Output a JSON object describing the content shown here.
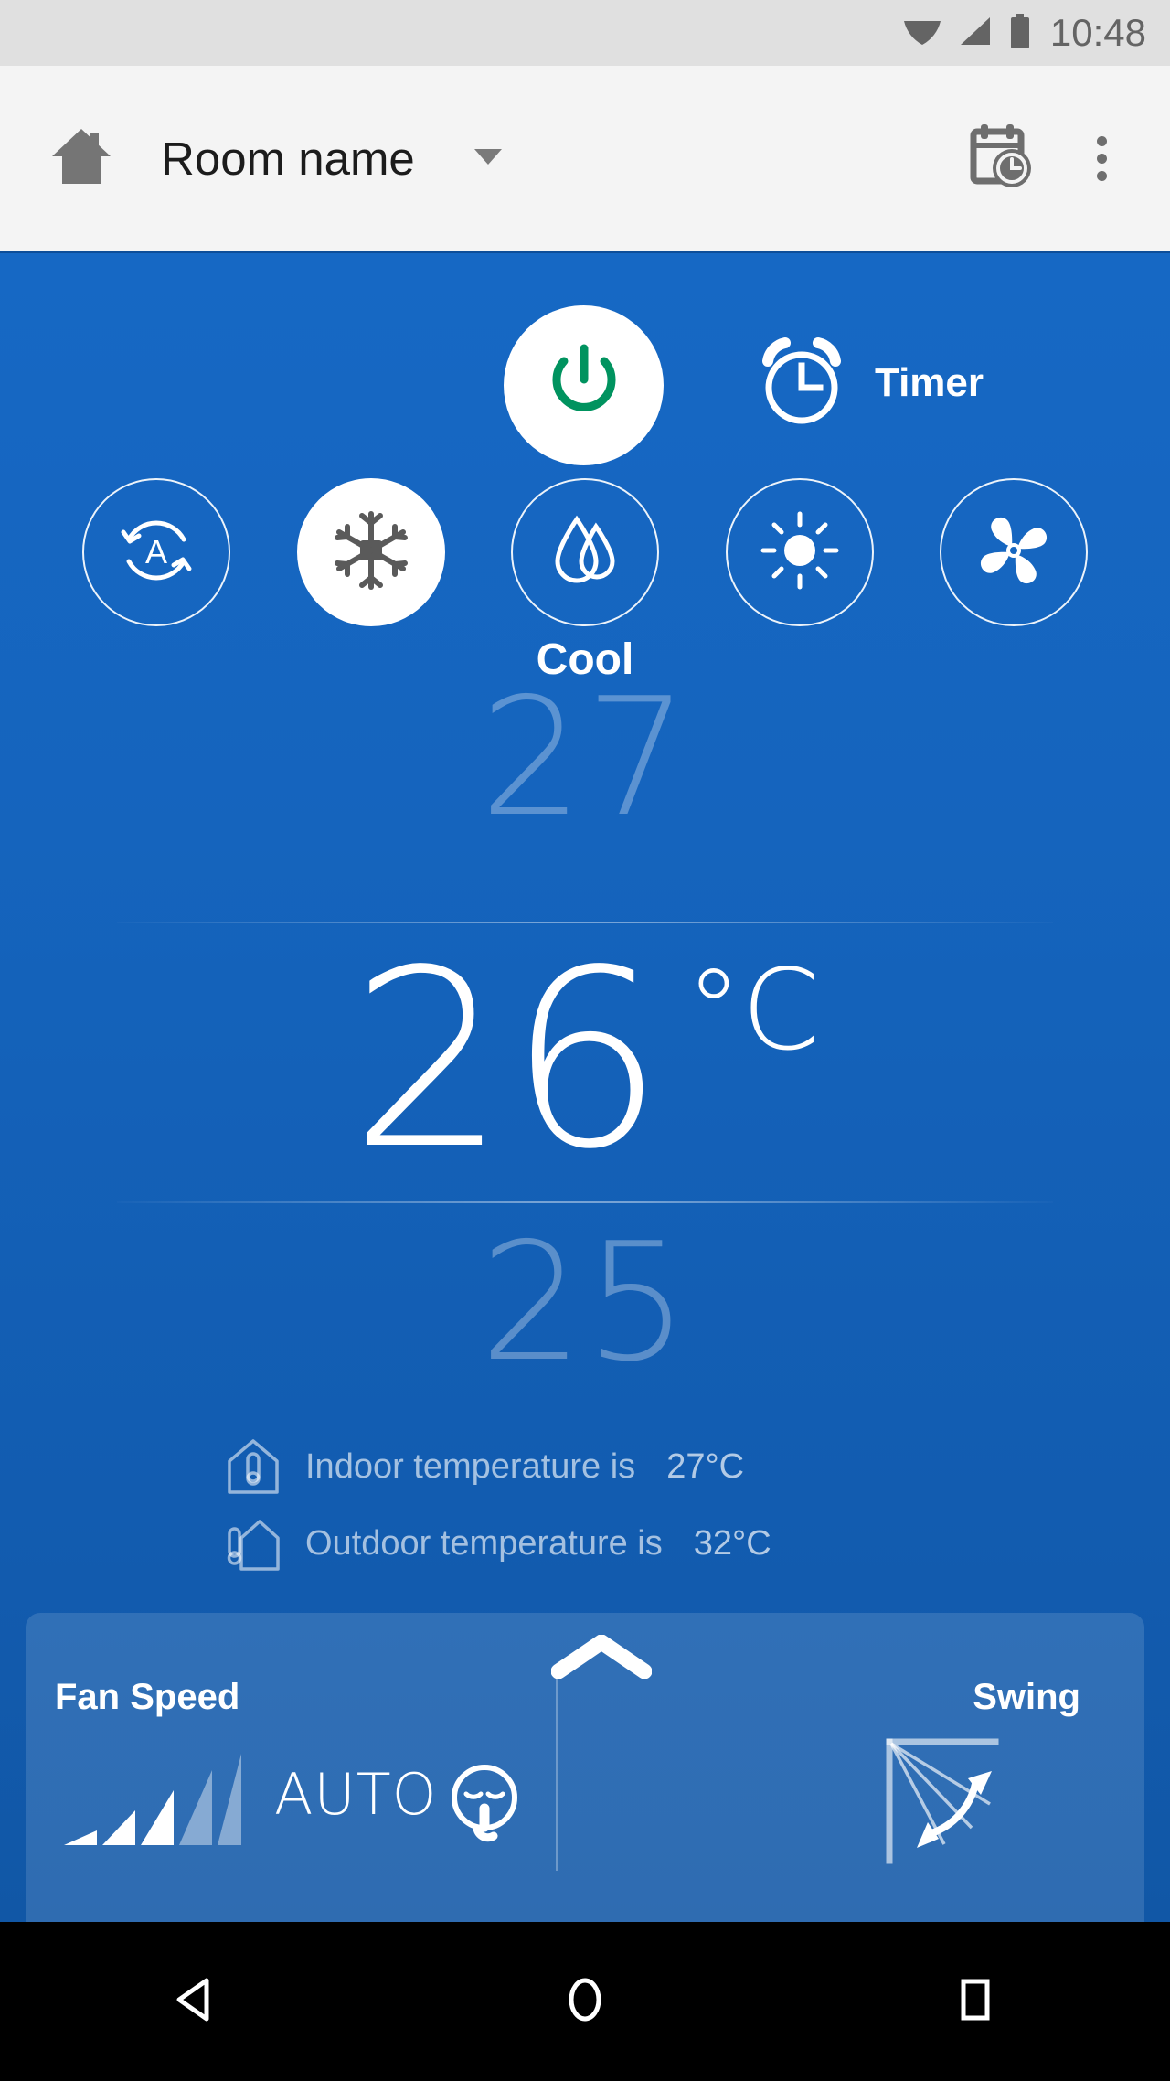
{
  "status_bar": {
    "time": "10:48",
    "icons": [
      "wifi-icon",
      "cellular-signal-icon",
      "battery-icon"
    ]
  },
  "app_bar": {
    "home_icon": "home-icon",
    "title": "Room name",
    "dropdown_icon": "chevron-down-icon",
    "schedule_icon": "calendar-clock-icon",
    "overflow_icon": "overflow-menu-icon"
  },
  "power": {
    "power_icon": "power-icon",
    "power_color": "#00935f",
    "timer_icon": "alarm-clock-icon",
    "timer_label": "Timer"
  },
  "modes": {
    "selected": "cool",
    "selected_label": "Cool",
    "items": [
      {
        "id": "auto",
        "icon": "auto-mode-icon",
        "selected": false
      },
      {
        "id": "cool",
        "icon": "snowflake-icon",
        "selected": true
      },
      {
        "id": "dry",
        "icon": "water-drop-icon",
        "selected": false
      },
      {
        "id": "heat",
        "icon": "sun-icon",
        "selected": false
      },
      {
        "id": "fan",
        "icon": "fan-icon",
        "selected": false
      }
    ]
  },
  "temperature": {
    "above": "27",
    "current": "26",
    "unit": "°C",
    "below": "25"
  },
  "readings": [
    {
      "icon": "indoor-thermometer-icon",
      "label": "Indoor temperature is",
      "value": "27°C"
    },
    {
      "icon": "outdoor-thermometer-icon",
      "label": "Outdoor temperature is",
      "value": "32°C"
    }
  ],
  "bottom_panel": {
    "expand_icon": "chevron-up-icon",
    "fan_speed_label": "Fan Speed",
    "fan_speed_value": "AUTO",
    "fan_bars_total": 5,
    "fan_bars_active": 3,
    "quiet_icon": "quiet-mode-icon",
    "swing_label": "Swing",
    "swing_icon": "swing-arc-icon"
  },
  "nav_bar": {
    "back_icon": "back-triangle-icon",
    "home_icon": "home-circle-icon",
    "recents_icon": "recents-square-icon"
  },
  "colors": {
    "accent_blue": "#1566c0",
    "power_green": "#00935f",
    "status_bar_bg": "#e0e0e0",
    "app_bar_bg": "#f4f4f4"
  }
}
